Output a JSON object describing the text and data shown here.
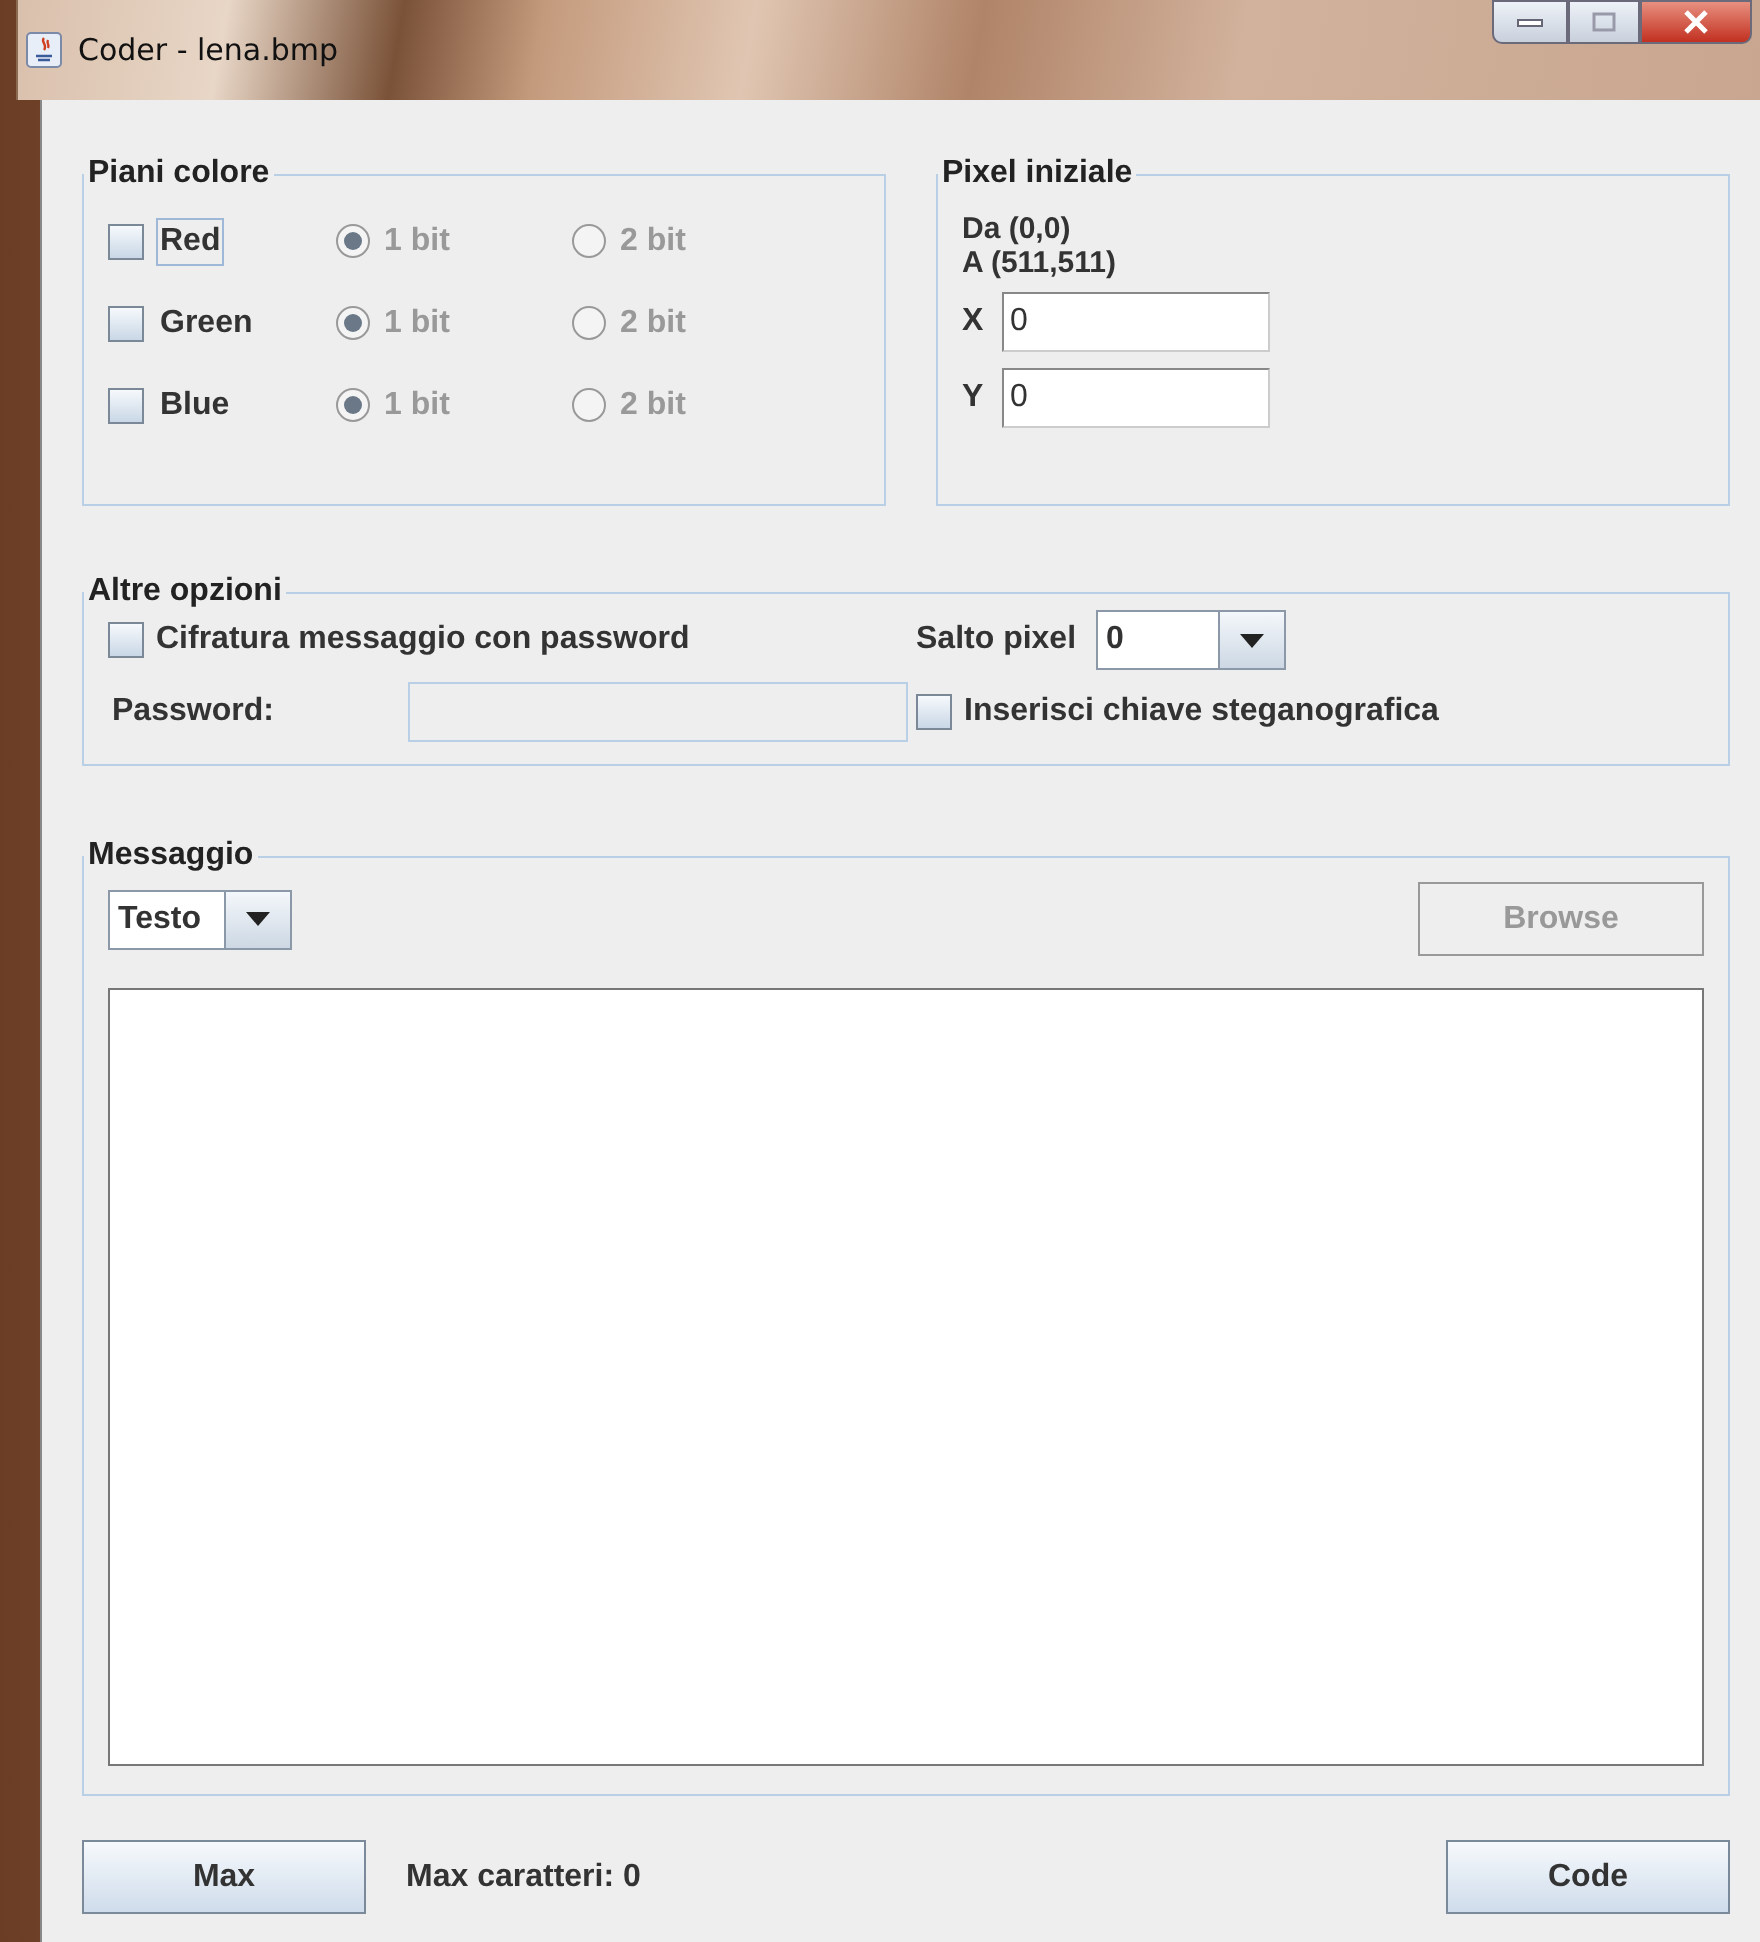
{
  "window": {
    "title": "Coder - lena.bmp"
  },
  "color_planes": {
    "title": "Piani colore",
    "rows": [
      {
        "label": "Red",
        "checked": false,
        "focused": true,
        "radios_enabled": false,
        "options": [
          {
            "label": "1 bit",
            "selected": true
          },
          {
            "label": "2 bit",
            "selected": false
          }
        ]
      },
      {
        "label": "Green",
        "checked": false,
        "focused": false,
        "radios_enabled": false,
        "options": [
          {
            "label": "1 bit",
            "selected": true
          },
          {
            "label": "2 bit",
            "selected": false
          }
        ]
      },
      {
        "label": "Blue",
        "checked": false,
        "focused": false,
        "radios_enabled": false,
        "options": [
          {
            "label": "1 bit",
            "selected": true
          },
          {
            "label": "2 bit",
            "selected": false
          }
        ]
      }
    ]
  },
  "start_pixel": {
    "title": "Pixel iniziale",
    "from": "Da (0,0)",
    "to": "A (511,511)",
    "fields": [
      {
        "label": "X",
        "value": "0"
      },
      {
        "label": "Y",
        "value": "0"
      }
    ]
  },
  "other_options": {
    "title": "Altre opzioni",
    "encrypt": {
      "label": "Cifratura messaggio con password",
      "checked": false
    },
    "password": {
      "label": "Password:",
      "disabled": true
    },
    "skip": {
      "label": "Salto pixel",
      "value": "0"
    },
    "key": {
      "label": "Inserisci chiave steganografica",
      "checked": false
    }
  },
  "message": {
    "title": "Messaggio",
    "type": {
      "value": "Testo"
    },
    "browse": {
      "label": "Browse",
      "disabled": true
    }
  },
  "footer": {
    "max_button": "Max",
    "max_chars": "Max caratteri: 0",
    "code_button": "Code"
  }
}
